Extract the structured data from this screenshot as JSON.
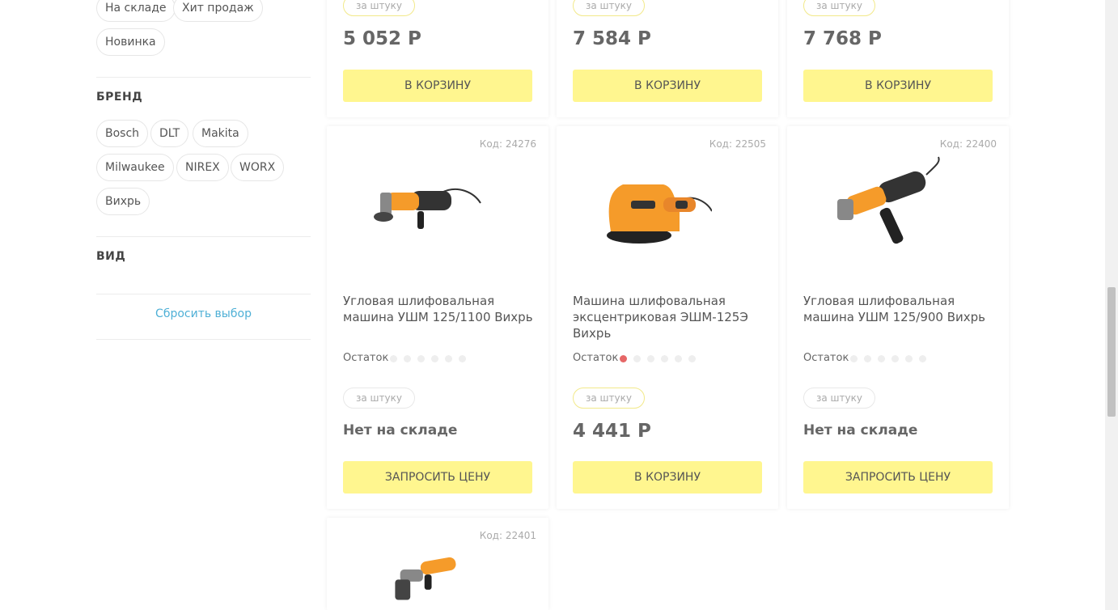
{
  "sidebar": {
    "status_chips": [
      "На складе",
      "Хит продаж",
      "Новинка"
    ],
    "brand_title": "БРЕНД",
    "brands": [
      "Bosch",
      "DLT",
      "Makita",
      "Milwaukee",
      "NIREX",
      "WORX",
      "Вихрь"
    ],
    "type_title": "ВИД",
    "reset_label": "Сбросить выбор"
  },
  "top_row": [
    {
      "unit": "за штуку",
      "price": "5 052 Р",
      "button": "В КОРЗИНУ"
    },
    {
      "unit": "за штуку",
      "price": "7 584 Р",
      "button": "В КОРЗИНУ"
    },
    {
      "unit": "за штуку",
      "price": "7 768 Р",
      "button": "В КОРЗИНУ"
    }
  ],
  "products": [
    {
      "code": "Код: 24276",
      "name": "Угловая шлифовальная машина УШМ 125/1100 Вихрь",
      "stock_label": "Остаток",
      "stock_level": 0,
      "unit": "за штуку",
      "availability": "Нет на складе",
      "button": "ЗАПРОСИТЬ ЦЕНУ"
    },
    {
      "code": "Код: 22505",
      "name": "Машина шлифовальная эксцентриковая ЭШМ-125Э Вихрь",
      "stock_label": "Остаток",
      "stock_level": 1,
      "unit": "за штуку",
      "price": "4 441 Р",
      "button": "В КОРЗИНУ"
    },
    {
      "code": "Код: 22400",
      "name": "Угловая шлифовальная машина УШМ 125/900 Вихрь",
      "stock_label": "Остаток",
      "stock_level": 0,
      "unit": "за штуку",
      "availability": "Нет на складе",
      "button": "ЗАПРОСИТЬ ЦЕНУ"
    },
    {
      "code": "Код: 22401"
    }
  ],
  "colors": {
    "button": "#fff68f",
    "link": "#4fb0d6",
    "stock_dot": "#e66767"
  }
}
